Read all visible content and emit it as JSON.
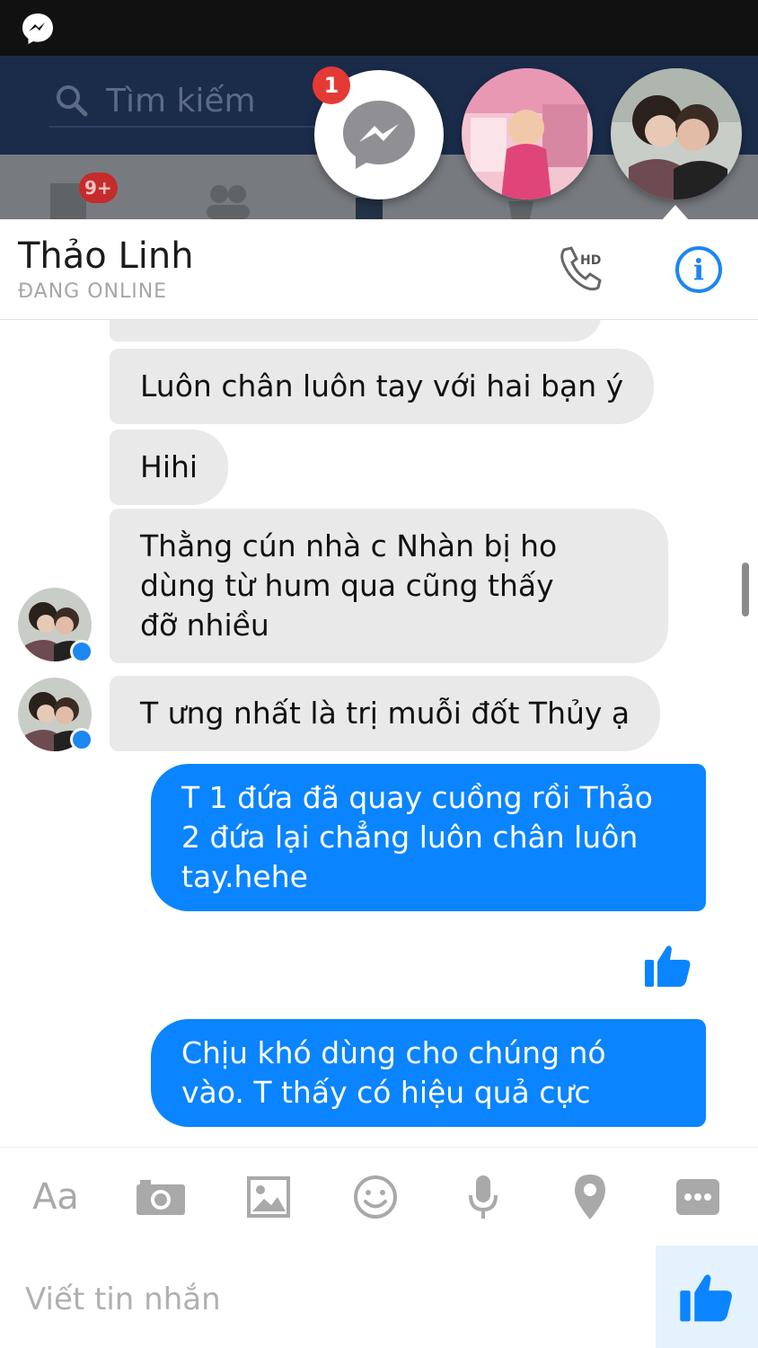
{
  "background_app": {
    "search_placeholder": "Tìm kiếm",
    "notification_badge": "9+"
  },
  "chat_heads": {
    "unread_count": "1",
    "icons": [
      "messenger-icon",
      "baby-photo-avatar",
      "couple-photo-avatar"
    ]
  },
  "conversation": {
    "contact_name": "Thảo Linh",
    "status": "ĐANG ONLINE",
    "call_label": "HD"
  },
  "messages": [
    {
      "direction": "incoming",
      "lines": [
        "Luôn chân luôn tay với hai bạn ý"
      ]
    },
    {
      "direction": "incoming",
      "lines": [
        "Hihi"
      ]
    },
    {
      "direction": "incoming",
      "lines": [
        "Thằng cún nhà c Nhàn bị ho",
        "dùng từ hum qua cũng thấy",
        "đỡ nhiều"
      ]
    },
    {
      "direction": "incoming",
      "lines": [
        "T ưng nhất là trị muỗi đốt Thủy ạ"
      ]
    },
    {
      "direction": "outgoing",
      "lines": [
        "T 1 đứa đã quay cuồng rồi Thảo",
        "2 đứa lại chẳng luôn chân luôn",
        "tay.hehe"
      ]
    },
    {
      "direction": "outgoing",
      "lines": [
        "Chịu khó dùng cho chúng nó",
        "vào. T thấy có hiệu quả cực"
      ]
    }
  ],
  "composer": {
    "aa_label": "Aa",
    "placeholder": "Viết tin nhắn",
    "tools": [
      "text-size-icon",
      "camera-icon",
      "gallery-icon",
      "emoji-icon",
      "microphone-icon",
      "location-icon",
      "more-icon"
    ]
  },
  "colors": {
    "outgoing_bubble": "#0a84ff",
    "incoming_bubble": "#e9e9ea",
    "accent": "#1d86f0"
  }
}
